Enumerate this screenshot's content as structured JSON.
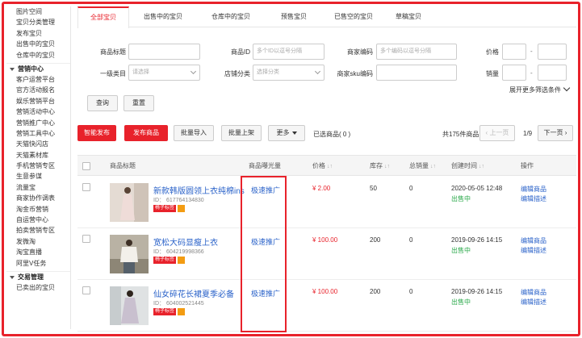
{
  "sidebar": {
    "top_items": [
      "图片空间",
      "宝贝分类管理",
      "发布宝贝",
      "出售中的宝贝",
      "仓库中的宝贝"
    ],
    "marketing_group": "营销中心",
    "marketing_items": [
      "客户运营平台",
      "官方活动报名",
      "娱乐营销平台",
      "营销活动中心",
      "营销推广中心",
      "营销工具中心",
      "天猫快闪店",
      "天猫素材库",
      "手机营销专区",
      "生意参谋",
      "流量宝",
      "商家协作调表",
      "淘金币营销",
      "自运营中心",
      "拍卖营销专区",
      "发微淘",
      "淘宝直播",
      "阿里V任务"
    ],
    "trade_group": "交易管理",
    "trade_items": [
      "已卖出的宝贝"
    ]
  },
  "tabs": [
    "全部宝贝",
    "出售中的宝贝",
    "仓库中的宝贝",
    "预售宝贝",
    "已售空的宝贝",
    "草稿宝贝"
  ],
  "filters": {
    "title_label": "商品标题",
    "id_label": "商品ID",
    "id_placeholder": "多个ID以逗号分隔",
    "code_label": "商家编码",
    "code_placeholder": "多个编码以逗号分隔",
    "price_label": "价格",
    "category_label": "一级类目",
    "category_placeholder": "请选择",
    "shop_cat_label": "店铺分类",
    "shop_cat_placeholder": "选择分类",
    "sku_code_label": "商家sku编码",
    "sales_label": "销量",
    "range_sep": "-",
    "more_filters": "展开更多筛选条件",
    "query_btn": "查询",
    "reset_btn": "重置"
  },
  "toolbar": {
    "smart_publish": "智能发布",
    "publish": "发布商品",
    "batch_import": "批量导入",
    "batch_list": "批量上架",
    "more": "更多",
    "selected": "已选商品( 0 )",
    "total": "共175件商品",
    "prev": "上一页",
    "page": "1/9",
    "next": "下一页"
  },
  "table": {
    "headers": [
      "商品标题",
      "商品曝光量",
      "价格",
      "库存",
      "总销量",
      "创建时间",
      "操作"
    ],
    "sort_glyph": "↓↑",
    "rows": [
      {
        "title": "新款韩版圆领上衣纯棉ins",
        "id": "ID： 617764134830",
        "badge": "椅子标签",
        "promo": "极速推广",
        "price": "¥ 2.00",
        "stock": "50",
        "sales": "0",
        "created": "2020-05-05 12:48",
        "status": "出售中",
        "edit": "编辑商品",
        "desc": "编辑描述"
      },
      {
        "title": "宽松大码显瘦上衣",
        "id": "ID： 604219998366",
        "badge": "椅子标签",
        "promo": "极速推广",
        "price": "¥ 100.00",
        "stock": "200",
        "sales": "0",
        "created": "2019-09-26 14:15",
        "status": "出售中",
        "edit": "编辑商品",
        "desc": "编辑描述"
      },
      {
        "title": "仙女碎花长裙夏季必备",
        "id": "ID： 604002521445",
        "badge": "椅子标签",
        "promo": "极速推广",
        "price": "¥ 100.00",
        "stock": "200",
        "sales": "0",
        "created": "2019-09-26 14:15",
        "status": "出售中",
        "edit": "编辑商品",
        "desc": "编辑描述"
      }
    ]
  },
  "colors": {
    "accent": "#e8222b",
    "link": "#2a62c9",
    "status": "#2aa84a"
  }
}
